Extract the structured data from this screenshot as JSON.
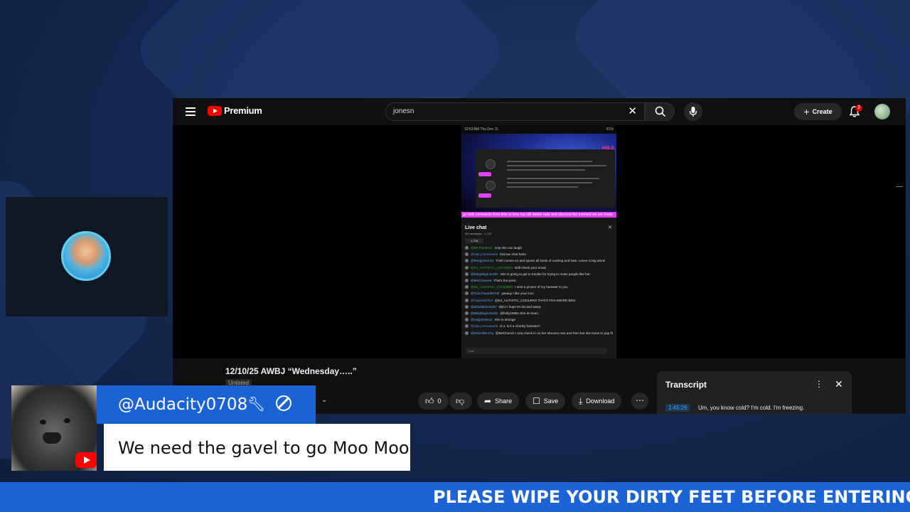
{
  "youtube": {
    "logo_text": "Premium",
    "search_value": "jonesn",
    "create_label": "Create",
    "notification_count": "3",
    "video_title": "12/10/25 AWBJ “Wednesday…..”",
    "visibility": "Unlisted",
    "actions": {
      "like_count": "0",
      "share_label": "Share",
      "save_label": "Save",
      "download_label": "Download"
    },
    "transcript": {
      "title": "Transcript",
      "timestamp": "1:45:26",
      "text": "Um, you know cold? I'm cold. I'm freezing."
    }
  },
  "embedded_screen": {
    "status_time": "10:53 AM  Thu Dec 11",
    "status_battery": "81%",
    "hold_text": "HOLD PLEASE",
    "pink_ticker": "go mds comments from time to time but still delete rude and obscene the moment we are made",
    "chat_title": "Live chat",
    "chat_subtitle": "All messages · 1,724",
    "viewer_pill": "1,738",
    "input_placeholder": "Chat...",
    "messages": [
      {
        "user": "@Mr.Prandmin",
        "text": "only she can laugh",
        "style": "green"
      },
      {
        "user": "@Spicy.Housewife",
        "text": "that tax chat haha",
        "style": "mod"
      },
      {
        "user": "@Ranjjonesn11",
        "text": "Truth comes on and spews all kinds of cussing and hate. Leave Craig alone",
        "style": "user"
      },
      {
        "user": "@DJ_AUTISTIC_COOLBRO",
        "text": "Brill check your email",
        "style": "green"
      },
      {
        "user": "@Daryldays-Invitin",
        "text": "She is going to get in trouble for trying to make people like her.",
        "style": "user"
      },
      {
        "user": "@MsCheeze9",
        "text": "That's the point",
        "style": "user"
      },
      {
        "user": "@DJ_AUTISTIC_COOLBRO",
        "text": "I sent a picture of my hamster to you",
        "style": "green"
      },
      {
        "user": "@Your.FavoriteTroll",
        "text": "yeaaay I like your icon",
        "style": "user"
      },
      {
        "user": "@HaplessChef",
        "text": "@DJ_AUTISTIC_COOLBRO THATS FKN WEIRD BRO",
        "style": "mod"
      },
      {
        "user": "@dolcedolce1187",
        "text": "@DJ I hope it's fat and sassy",
        "style": "user"
      },
      {
        "user": "@Darylkays-Invitin",
        "text": "@holly1995c She is mean.",
        "style": "user"
      },
      {
        "user": "@ranjjonesn11",
        "text": "She is strange",
        "style": "user"
      },
      {
        "user": "@Spicy.Housewife",
        "text": "D.J. is it a chonky hamster?",
        "style": "mod"
      },
      {
        "user": "@Stormi85-s7q",
        "text": "@MsCheeze I only check in on her streams now and then but she loves to pop the tab of a cold one. don't know if it was beer 🍺 or pop",
        "style": "user"
      }
    ]
  },
  "overlay": {
    "commenter": "@Audacity0708",
    "comment": "We need the gavel to go Moo Moo",
    "ticker": "PLEASE WIPE YOUR DIRTY FEET BEFORE ENTERING!!"
  },
  "colors": {
    "accent_blue": "#1b63d4",
    "youtube_red": "#ff0000",
    "background": "#142a52"
  },
  "icons": [
    "menu-icon",
    "youtube-logo-icon",
    "close-icon",
    "search-icon",
    "mic-icon",
    "plus-icon",
    "bell-icon",
    "like-icon",
    "dislike-icon",
    "share-icon",
    "save-icon",
    "download-icon",
    "more-icon",
    "wrench-icon",
    "ban-icon"
  ]
}
